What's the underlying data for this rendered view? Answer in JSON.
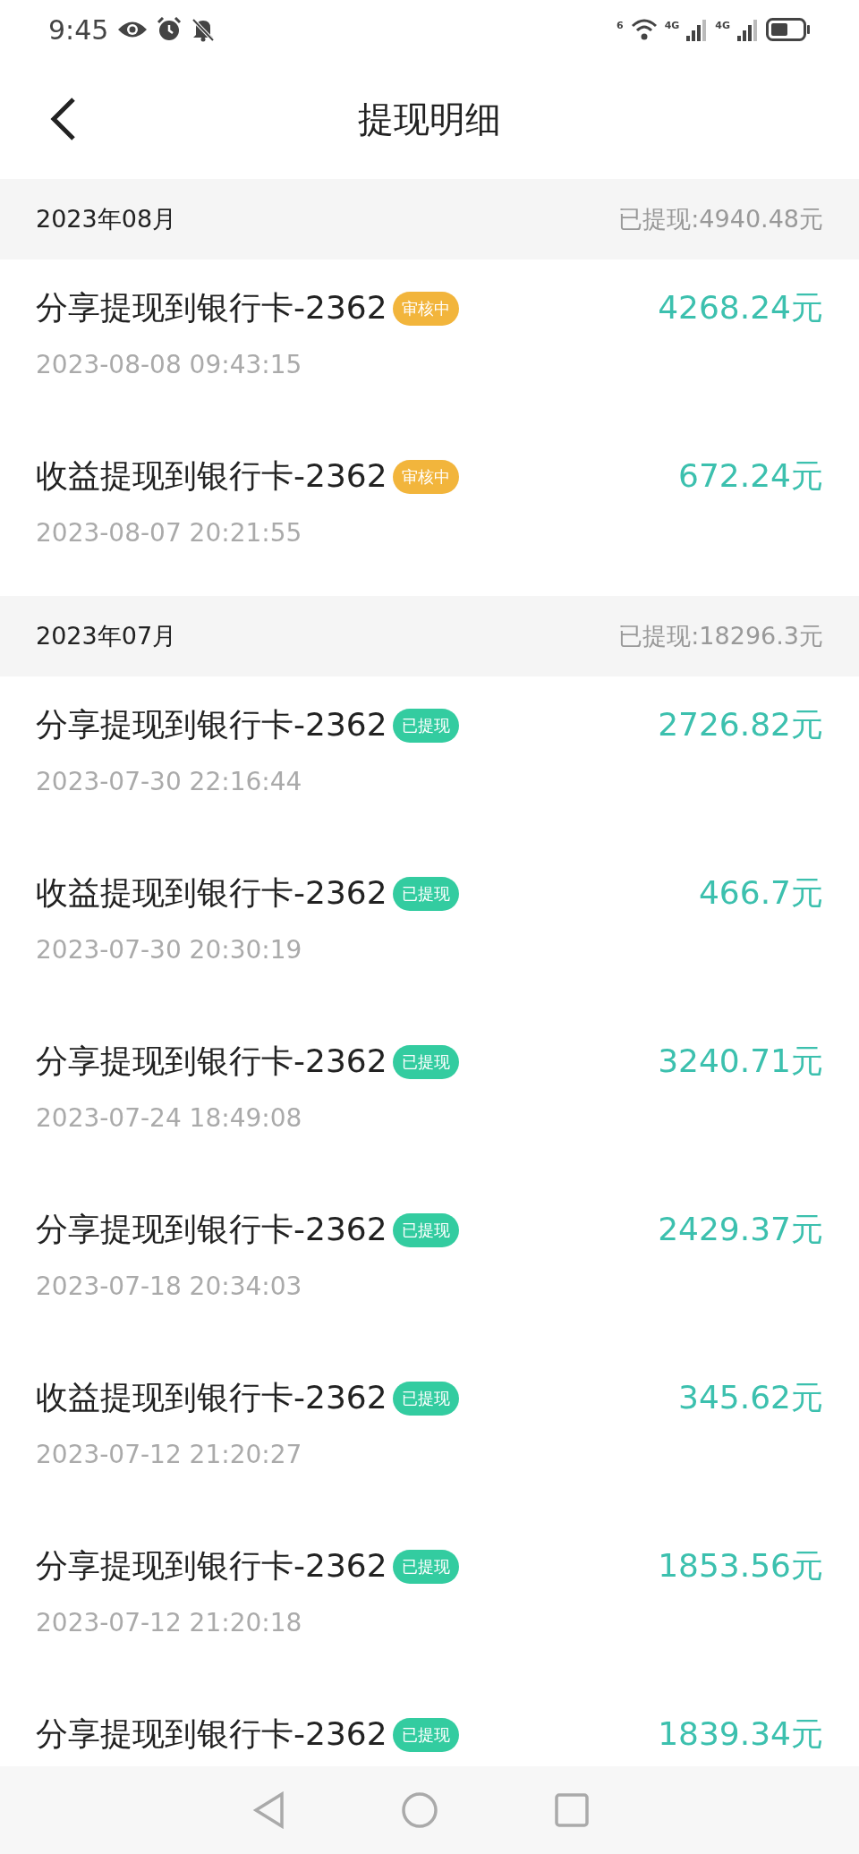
{
  "status_bar": {
    "time": "9:45",
    "wifi_label": "6",
    "signal_labels": [
      "4G",
      "4G"
    ]
  },
  "header": {
    "title": "提现明细"
  },
  "sections": [
    {
      "month": "2023年08月",
      "total": "已提现:4940.48元",
      "records": [
        {
          "title": "分享提现到银行卡-2362",
          "status": "审核中",
          "kind": "pending",
          "time": "2023-08-08 09:43:15",
          "amount": "4268.24元"
        },
        {
          "title": "收益提现到银行卡-2362",
          "status": "审核中",
          "kind": "pending",
          "time": "2023-08-07 20:21:55",
          "amount": "672.24元"
        }
      ]
    },
    {
      "month": "2023年07月",
      "total": "已提现:18296.3元",
      "records": [
        {
          "title": "分享提现到银行卡-2362",
          "status": "已提现",
          "kind": "done",
          "time": "2023-07-30 22:16:44",
          "amount": "2726.82元"
        },
        {
          "title": "收益提现到银行卡-2362",
          "status": "已提现",
          "kind": "done",
          "time": "2023-07-30 20:30:19",
          "amount": "466.7元"
        },
        {
          "title": "分享提现到银行卡-2362",
          "status": "已提现",
          "kind": "done",
          "time": "2023-07-24 18:49:08",
          "amount": "3240.71元"
        },
        {
          "title": "分享提现到银行卡-2362",
          "status": "已提现",
          "kind": "done",
          "time": "2023-07-18 20:34:03",
          "amount": "2429.37元"
        },
        {
          "title": "收益提现到银行卡-2362",
          "status": "已提现",
          "kind": "done",
          "time": "2023-07-12 21:20:27",
          "amount": "345.62元"
        },
        {
          "title": "分享提现到银行卡-2362",
          "status": "已提现",
          "kind": "done",
          "time": "2023-07-12 21:20:18",
          "amount": "1853.56元"
        },
        {
          "title": "分享提现到银行卡-2362",
          "status": "已提现",
          "kind": "done",
          "amount": "1839.34元"
        }
      ]
    }
  ]
}
